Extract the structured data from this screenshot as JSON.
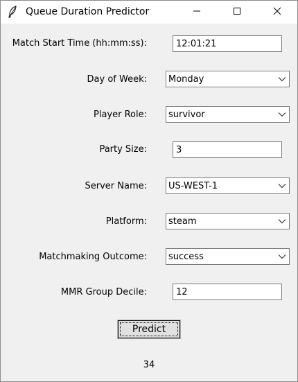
{
  "window": {
    "title": "Queue Duration Predictor",
    "icons": {
      "app": "feather-icon",
      "minimize": "minimize-icon",
      "maximize": "maximize-icon",
      "close": "close-icon"
    }
  },
  "form": {
    "match_start_time": {
      "label": "Match Start Time (hh:mm:ss):",
      "value": "12:01:21"
    },
    "day_of_week": {
      "label": "Day of Week:",
      "value": "Monday"
    },
    "player_role": {
      "label": "Player Role:",
      "value": "survivor"
    },
    "party_size": {
      "label": "Party Size:",
      "value": "3"
    },
    "server_name": {
      "label": "Server Name:",
      "value": "US-WEST-1"
    },
    "platform": {
      "label": "Platform:",
      "value": "steam"
    },
    "matchmaking_outcome": {
      "label": "Matchmaking Outcome:",
      "value": "success"
    },
    "mmr_group_decile": {
      "label": "MMR Group Decile:",
      "value": "12"
    }
  },
  "predict_button": {
    "label": "Predict"
  },
  "result": {
    "value": "34"
  }
}
